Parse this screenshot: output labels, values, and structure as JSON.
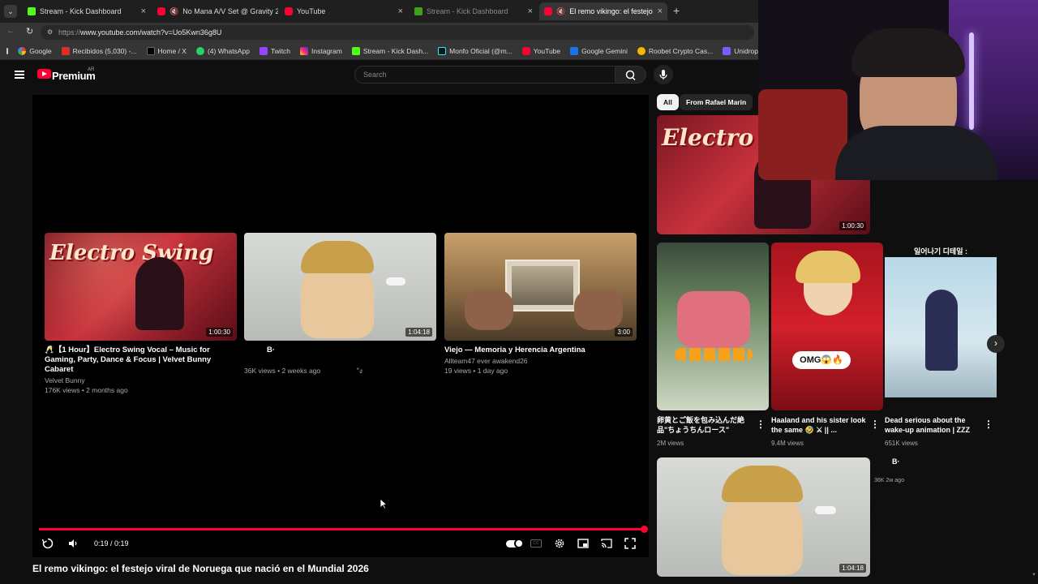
{
  "browser": {
    "tabs": [
      {
        "title": "Stream - Kick Dashboard",
        "icon": "kick-icon",
        "muted": false,
        "active": false
      },
      {
        "title": "No Mana A/V Set @ Gravity 2",
        "icon": "youtube-icon",
        "muted": true,
        "active": false
      },
      {
        "title": "YouTube",
        "icon": "youtube-icon",
        "muted": false,
        "active": false
      },
      {
        "title": "Stream - Kick Dashboard",
        "icon": "kick-icon",
        "muted": false,
        "active": false
      },
      {
        "title": "El remo vikingo: el festejo vira",
        "icon": "youtube-icon",
        "muted": true,
        "active": true
      }
    ],
    "url_prefix": "https://",
    "url_main": "www.youtube.com/watch?v=Uo5Kwn36g8U",
    "bookmarks": [
      "Google",
      "Recibidos (5,030) -...",
      "Home / X",
      "(4) WhatsApp",
      "Twitch",
      "Instagram",
      "Stream - Kick Dash...",
      "Monfo Oficial (@m...",
      "YouTube",
      "Google Gemini",
      "Roobet Crypto Cas...",
      "Unidrop"
    ]
  },
  "youtube": {
    "logo_text": "Premium",
    "logo_region": "AR",
    "search_placeholder": "Search"
  },
  "player": {
    "end_cards": [
      {
        "title": "🥂【1 Hour】Electro Swing Vocal – Music for Gaming, Party, Dance & Focus | Velvet Bunny Cabaret",
        "channel": "Velvet Bunny",
        "meta": "176K views • 2 months ago",
        "duration": "1:00:30",
        "thumb_text": "Electro Swing"
      },
      {
        "title": "B·",
        "channel": "",
        "meta": "36K views • 2 weeks ago",
        "duration": "1:04:18",
        "extra": "ัง"
      },
      {
        "title": "Viejo — Memoria y Herencia Argentina",
        "channel": "Allteam47 ever awakend26",
        "meta": "19 views • 1 day ago",
        "duration": "3:00"
      }
    ],
    "time": "0:19 / 0:19",
    "progress": 1.0
  },
  "video_title": "El remo vikingo: el festejo viral de Noruega que nació en el Mundial 2026",
  "sidebar": {
    "chips": [
      {
        "label": "All",
        "selected": true
      },
      {
        "label": "From Rafael Marin",
        "selected": false
      }
    ],
    "top_video": {
      "duration": "1:00:30",
      "thumb_text": "Electro Swing"
    },
    "shorts": [
      {
        "title": "卵黄とご飯を包み込んだ絶品\"ちょうちんロース\"",
        "views": "2M views"
      },
      {
        "title": "Haaland and his sister look the same 🤣 ⚔ || ...",
        "views": "9.4M views",
        "overlay": "OMG😱🔥"
      },
      {
        "title": "Dead serious about the wake-up animation | ZZZ",
        "views": "651K views",
        "overlay": "일어나기 디테일 :"
      }
    ],
    "bottom_video": {
      "duration": "1:04:18",
      "title": "B·",
      "meta": "36K  2w ago"
    }
  }
}
